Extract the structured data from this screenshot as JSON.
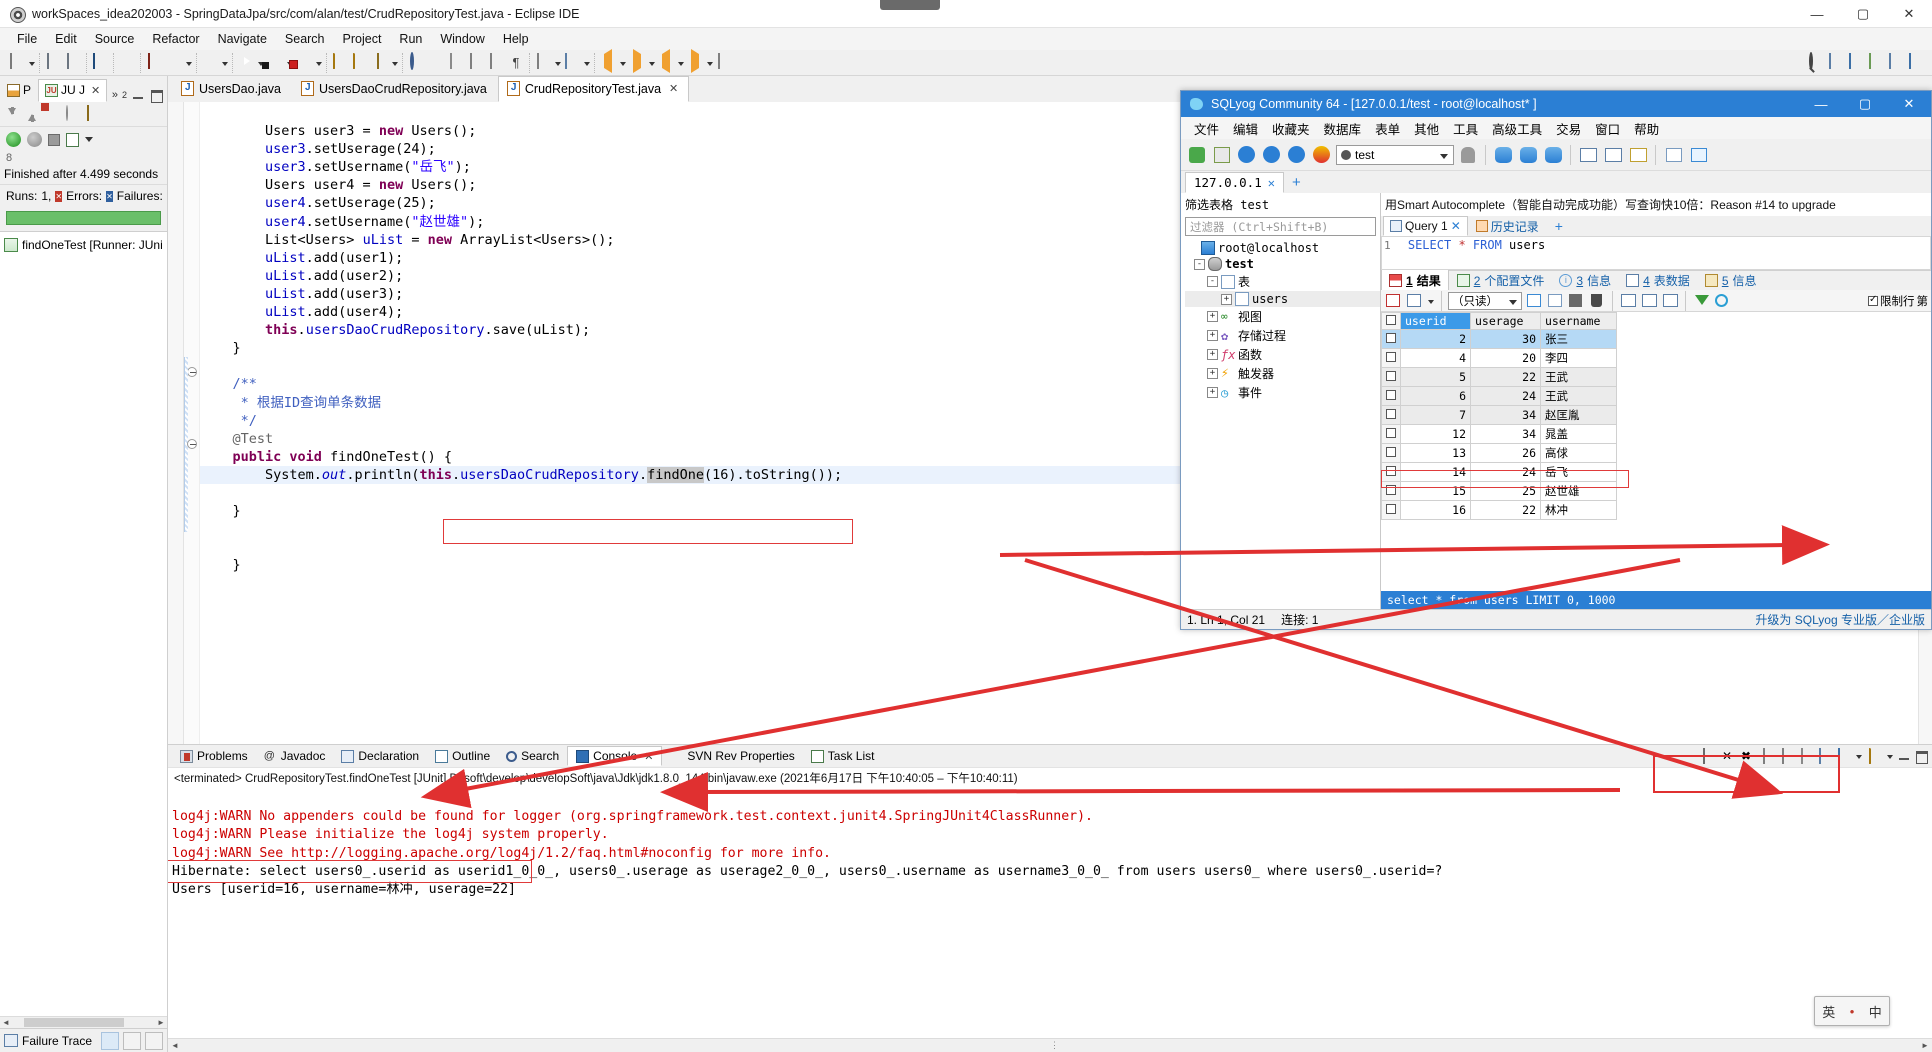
{
  "eclipse": {
    "title": "workSpaces_idea202003 - SpringDataJpa/src/com/alan/test/CrudRepositoryTest.java - Eclipse IDE",
    "window_buttons": {
      "minimize": "—",
      "maximize": "▢",
      "close": "✕"
    },
    "menu": [
      "File",
      "Edit",
      "Source",
      "Refactor",
      "Navigate",
      "Search",
      "Project",
      "Run",
      "Window",
      "Help"
    ],
    "junit": {
      "tabs": [
        {
          "label": "P",
          "icon": "package-explorer-icon"
        },
        {
          "label": "JU J",
          "icon": "junit-icon"
        }
      ],
      "overflow": "»",
      "overflow_count": "2",
      "status": "Finished after 4.499 seconds",
      "dots": "8",
      "counts": {
        "runs_label": "Runs:",
        "runs_value": "1,",
        "errors_label": "Errors:",
        "errors_value": "",
        "failures_label": "Failures:",
        "failures_value": ""
      },
      "tree_item": "findOneTest [Runner: JUni",
      "failure_trace": "Failure Trace",
      "toolbar_icons": [
        "next-failure-icon",
        "previous-failure-icon",
        "show-failures-only-icon",
        "no-errors-icon",
        "lock-icon"
      ],
      "toolbar2_icons": [
        "rerun-test-icon",
        "rerun-failed-icon",
        "stop-icon",
        "test-history-icon",
        "view-menu-icon"
      ]
    },
    "editor": {
      "tabs": [
        {
          "label": "UsersDao.java",
          "active": false,
          "closable": false
        },
        {
          "label": "UsersDaoCrudRepository.java",
          "active": false,
          "closable": false
        },
        {
          "label": "CrudRepositoryTest.java",
          "active": true,
          "closable": true
        }
      ],
      "close_glyph": "✕",
      "lines": [
        "        Users user3 = new Users();",
        "        user3.setUserage(24);",
        "        user3.setUsername(\"岳飞\");",
        "        Users user4 = new Users();",
        "        user4.setUserage(25);",
        "        user4.setUsername(\"赵世雄\");",
        "        List<Users> uList = new ArrayList<Users>();",
        "        uList.add(user1);",
        "        uList.add(user2);",
        "        uList.add(user3);",
        "        uList.add(user4);",
        "        this.usersDaoCrudRepository.save(uList);",
        "    }",
        "",
        "    /**",
        "     * 根据ID查询单条数据",
        "     */",
        "    @Test",
        "    public void findOneTest() {",
        "        System.out.println(this.usersDaoCrudRepository.findOne(16).toString());",
        "    }",
        "",
        "",
        "    }"
      ],
      "highlighted_expression": "this.usersDaoCrudRepository.findOne(16).toString()"
    },
    "console": {
      "tabs": [
        {
          "label": "Problems",
          "icon": "problems-icon",
          "active": false
        },
        {
          "label": "Javadoc",
          "icon": "javadoc-icon",
          "active": false
        },
        {
          "label": "Declaration",
          "icon": "declaration-icon",
          "active": false
        },
        {
          "label": "Outline",
          "icon": "outline-icon",
          "active": false
        },
        {
          "label": "Search",
          "icon": "search-icon",
          "active": false
        },
        {
          "label": "Console",
          "icon": "console-icon",
          "active": true
        },
        {
          "label": "SVN Rev Properties",
          "icon": "svn-icon",
          "active": false
        },
        {
          "label": "Task List",
          "icon": "task-list-icon",
          "active": false
        }
      ],
      "close_glyph": "✕",
      "launch_line": "<terminated> CrudRepositoryTest.findOneTest [JUnit] D:\\soft\\develop\\developSoft\\java\\Jdk\\jdk1.8.0_144\\bin\\javaw.exe  (2021年6月17日 下午10:40:05 – 下午10:40:11)",
      "output": [
        {
          "text": "log4j:WARN No appenders could be found for logger (org.springframework.test.context.junit4.SpringJUnit4ClassRunner).",
          "color": "error"
        },
        {
          "text": "log4j:WARN Please initialize the log4j system properly.",
          "color": "error"
        },
        {
          "text": "log4j:WARN See http://logging.apache.org/log4j/1.2/faq.html#noconfig for more info.",
          "color": "error"
        },
        {
          "text": "Hibernate: select users0_.userid as userid1_0_0_, users0_.userage as userage2_0_0_, users0_.username as username3_0_0_ from users users0_ where users0_.userid=?",
          "color": "normal"
        },
        {
          "text": "Users [userid=16, username=林冲, userage=22]",
          "color": "normal"
        }
      ]
    }
  },
  "sqlyog": {
    "title": "SQLyog Community 64 - [127.0.0.1/test - root@localhost* ]",
    "window_buttons": {
      "minimize": "—",
      "maximize": "▢",
      "close": "✕"
    },
    "menu": [
      "文件",
      "编辑",
      "收藏夹",
      "数据库",
      "表单",
      "其他",
      "工具",
      "高级工具",
      "交易",
      "窗口",
      "帮助"
    ],
    "db_selector": "test",
    "connection_tab": "127.0.0.1",
    "connection_tab_close": "✕",
    "new_tab_glyph": "+",
    "filter_label": "筛选表格 test",
    "filter_placeholder": "过滤器 (Ctrl+Shift+B)",
    "tree": [
      {
        "label": "root@localhost",
        "icon": "server-icon",
        "indent": 0,
        "expander": ""
      },
      {
        "label": "test",
        "icon": "database-icon",
        "indent": 1,
        "expander": "-",
        "bold": true
      },
      {
        "label": "表",
        "icon": "table-group-icon",
        "indent": 2,
        "expander": "-"
      },
      {
        "label": "users",
        "icon": "table-icon",
        "indent": 3,
        "expander": "+",
        "selected": true
      },
      {
        "label": "视图",
        "icon": "view-icon",
        "indent": 2,
        "expander": "+"
      },
      {
        "label": "存储过程",
        "icon": "procedure-icon",
        "indent": 2,
        "expander": "+"
      },
      {
        "label": "函数",
        "icon": "function-icon",
        "indent": 2,
        "expander": "+"
      },
      {
        "label": "触发器",
        "icon": "trigger-icon",
        "indent": 2,
        "expander": "+"
      },
      {
        "label": "事件",
        "icon": "event-icon",
        "indent": 2,
        "expander": "+"
      }
    ],
    "banner": "用Smart Autocomplete（智能自动完成功能）写查询快10倍：Reason #14 to upgrade",
    "query_tabs": [
      {
        "label": "Query 1",
        "icon": "query-icon",
        "active": true,
        "close": "✕"
      },
      {
        "label": "历史记录",
        "icon": "history-icon",
        "active": false
      }
    ],
    "query_add": "+",
    "query_line_no": "1",
    "query_sql": "SELECT * FROM users",
    "result_tabs": [
      {
        "num": "1",
        "label": "结果",
        "icon": "result-grid-icon",
        "active": true
      },
      {
        "num": "2",
        "label": "个配置文件",
        "icon": "profile-icon",
        "active": false
      },
      {
        "num": "3",
        "label": "信息",
        "icon": "info-icon",
        "active": false
      },
      {
        "num": "4",
        "label": "表数据",
        "icon": "table-data-icon",
        "active": false
      },
      {
        "num": "5",
        "label": "信息",
        "icon": "message-icon",
        "active": false
      }
    ],
    "grid_toolbar": {
      "readonly_label": "（只读）",
      "limit_label": "限制行",
      "limit_suffix": "第"
    },
    "grid": {
      "columns": [
        "userid",
        "userage",
        "username"
      ],
      "rows": [
        {
          "userid": "2",
          "userage": "30",
          "username": "张三",
          "selected": true
        },
        {
          "userid": "4",
          "userage": "20",
          "username": "李四",
          "selected": false
        },
        {
          "userid": "5",
          "userage": "22",
          "username": "王武",
          "selected": false
        },
        {
          "userid": "6",
          "userage": "24",
          "username": "王武",
          "selected": false
        },
        {
          "userid": "7",
          "userage": "34",
          "username": "赵匡胤",
          "selected": false
        },
        {
          "userid": "12",
          "userage": "34",
          "username": "晁盖",
          "selected": false
        },
        {
          "userid": "13",
          "userage": "26",
          "username": "高俅",
          "selected": false
        },
        {
          "userid": "14",
          "userage": "24",
          "username": "岳飞",
          "selected": false
        },
        {
          "userid": "15",
          "userage": "25",
          "username": "赵世雄",
          "selected": false
        },
        {
          "userid": "16",
          "userage": "22",
          "username": "林冲",
          "selected": false,
          "highlighted": true
        }
      ]
    },
    "status_sql": "select * from users LIMIT 0, 1000",
    "footer": {
      "position": "1. Ln 1, Col 21",
      "connection": "连接: 1",
      "upgrade": "升级为 SQLyog 专业版／企业版"
    }
  },
  "ime": {
    "lang": "英",
    "dot": "•",
    "extra": "中"
  }
}
